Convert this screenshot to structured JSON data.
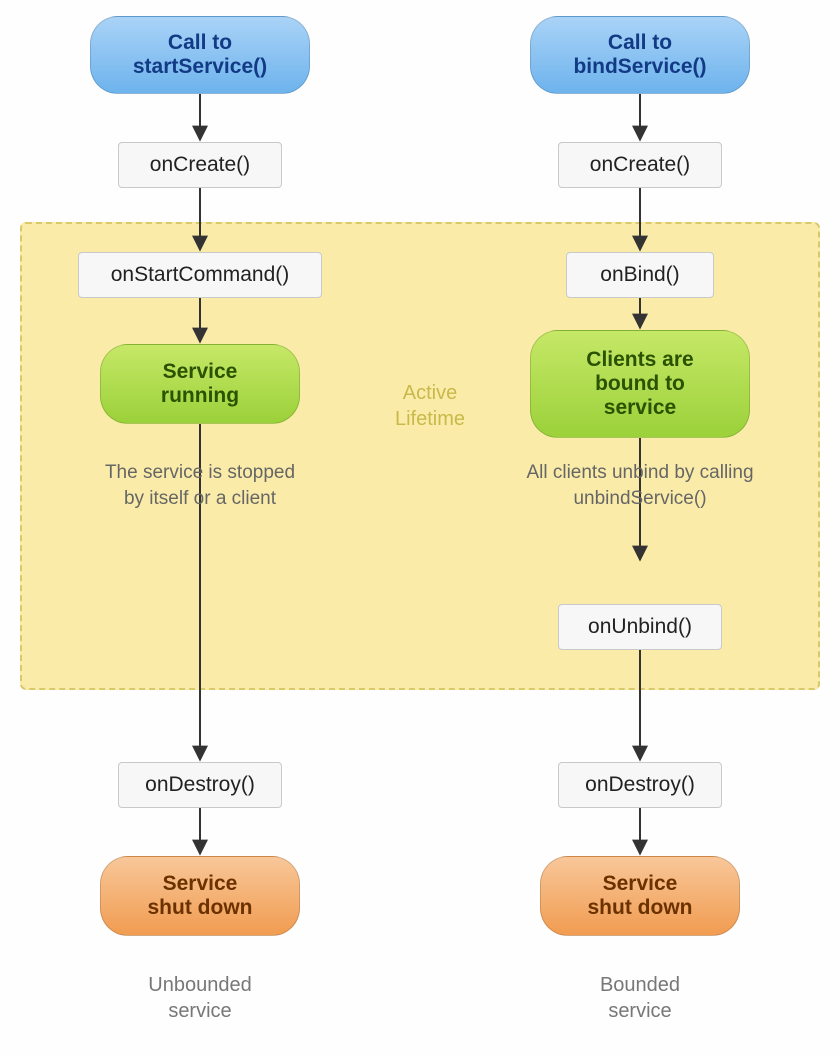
{
  "left": {
    "start": "Call to\nstartService()",
    "onCreate": "onCreate()",
    "onStartCommand": "onStartCommand()",
    "running": "Service\nrunning",
    "note": "The service is stopped\nby itself or a client",
    "onDestroy": "onDestroy()",
    "shutdown": "Service\nshut down",
    "caption": "Unbounded\nservice"
  },
  "right": {
    "start": "Call to\nbindService()",
    "onCreate": "onCreate()",
    "onBind": "onBind()",
    "bound": "Clients are\nbound to\nservice",
    "note": "All clients unbind by calling\nunbindService()",
    "onUnbind": "onUnbind()",
    "onDestroy": "onDestroy()",
    "shutdown": "Service\nshut down",
    "caption": "Bounded\nservice"
  },
  "activeLabel": "Active\nLifetime"
}
